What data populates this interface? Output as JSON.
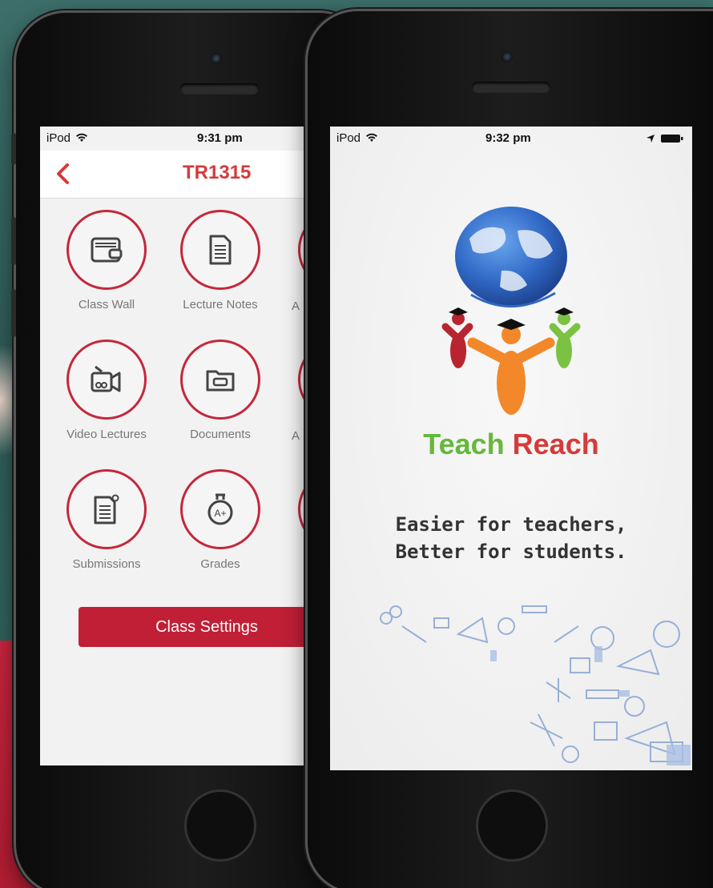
{
  "back_screen": {
    "status": {
      "carrier": "iPod",
      "time": "9:31 pm"
    },
    "nav_title": "TR1315",
    "tiles": [
      {
        "label": "Class Wall"
      },
      {
        "label": "Lecture Notes"
      },
      {
        "label": "Video Lectures"
      },
      {
        "label": "Documents"
      },
      {
        "label": "Submissions"
      },
      {
        "label": "Grades"
      }
    ],
    "partial_labels": [
      "A",
      "A"
    ],
    "grade_badge": "A+",
    "settings_button": "Class Settings"
  },
  "front_screen": {
    "status": {
      "carrier": "iPod",
      "time": "9:32 pm"
    },
    "brand": {
      "part1": "Teach",
      "part2": "Reach"
    },
    "tagline": {
      "line1": "Easier for teachers,",
      "line2": "Better for students."
    }
  },
  "colors": {
    "accent_red": "#c4283b",
    "brand_green": "#66b83b",
    "brand_red": "#d63a3a",
    "globe_blue": "#2f67c4",
    "figure_orange": "#f2882a"
  }
}
